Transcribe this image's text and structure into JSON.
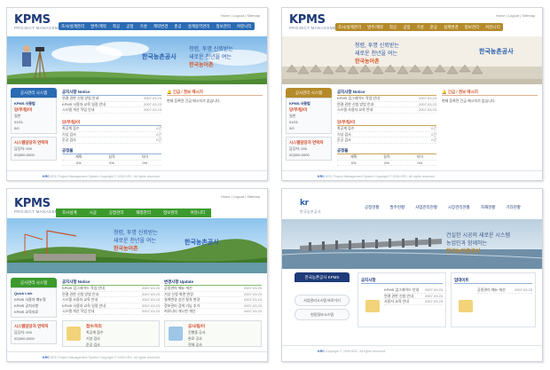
{
  "t1": {
    "logo": "KPMS",
    "logo_sub": "PROJECT MANAGEMENT",
    "menu": [
      "조사/설계관리",
      "발주/계약",
      "착공",
      "공정",
      "기성",
      "계약변경",
      "준공",
      "설계용역관리",
      "정보관리",
      "커뮤니티"
    ],
    "slogan_1": "청렴, 투명 신뢰받는",
    "slogan_2": "새로운 천년을 여는",
    "slogan_3": "한국농어촌",
    "krc": "한국농촌공사",
    "side_tab": "공사관리 시스템",
    "side_title": "KPMS 사용법",
    "side_lines": [
      "당/부/팀/이",
      "일반",
      "01/01",
      "0/0"
    ],
    "side_notice": "시스템담당자 연락처",
    "side_tel": [
      "담당자: 000",
      "02)000-0000"
    ],
    "notice_title": "공지사항 Notice",
    "notices": [
      {
        "t": "연결 권한 신청 방법 안내",
        "d": "2007.03.23"
      },
      {
        "t": "KPMS 사용자 교육 일정 안내",
        "d": "2007.03.23"
      },
      {
        "t": "시스템 개선 작업 안내",
        "d": "2007.03.23"
      }
    ],
    "alert_title": "긴급 / 경보 메시지",
    "alert_text": "현재 등록된 긴급 메시지가 없습니다.",
    "approval_title": "당/부/팀/이",
    "approvals": [
      {
        "t": "착공계 접수",
        "d": "0건"
      },
      {
        "t": "기성 검사",
        "d": "0건"
      },
      {
        "t": "준공 검사",
        "d": "0건"
      }
    ],
    "status_title": "공정율",
    "status_cols": [
      "계획",
      "실적",
      "차이"
    ],
    "status_vals": [
      "0%",
      "0%",
      "0%"
    ],
    "footer": "KRC Project Management System Copyright © 2006 KRC. All rights reserved."
  },
  "t2": {
    "logo": "KPMS",
    "logo_sub": "PROJECT MANAGEMENT",
    "menu": [
      "조사/설계관리",
      "발주/계약",
      "착공",
      "공정",
      "기성",
      "준공",
      "설계변경",
      "정보관리",
      "커뮤니티"
    ],
    "slogan_1": "청렴, 투명 신뢰받는",
    "slogan_2": "새로운 천년을 여는",
    "slogan_3": "한국농어촌",
    "krc": "한국농촌공사",
    "side_tab": "공사관리 시스템",
    "side_title": "KPMS 사용법",
    "side_lines": [
      "당/부/팀/이",
      "일반",
      "01/01",
      "0/0"
    ],
    "side_notice": "시스템담당자 연락처",
    "side_tel": [
      "담당자: 000",
      "02)000-0000"
    ],
    "notice_title": "공지사항 Notice",
    "notices": [
      {
        "t": "KPMS 업그레이드 작업 안내",
        "d": "2007.03.23"
      },
      {
        "t": "연결 권한 신청 방법 안내",
        "d": "2007.03.23"
      },
      {
        "t": "시스템 사용자 교육 안내",
        "d": "2007.03.23"
      }
    ],
    "alert_title": "긴급 / 경보 메시지",
    "alert_text": "현재 등록된 긴급 메시지가 없습니다.",
    "approval_title": "당/부/팀/이",
    "approvals": [
      {
        "t": "착공계 접수",
        "d": "0건"
      },
      {
        "t": "기성 검사",
        "d": "0건"
      },
      {
        "t": "준공 검사",
        "d": "0건"
      }
    ],
    "status_title": "공정율",
    "status_cols": [
      "계획",
      "실적",
      "차이"
    ],
    "status_vals": [
      "0%",
      "0%",
      "0%"
    ],
    "footer": "KRC Project Management System Copyright © 2006 KRC. All rights reserved."
  },
  "t3": {
    "logo": "KPMS",
    "logo_sub": "PROJECT MANAGEMENT",
    "menu": [
      "조사설계",
      "시공",
      "공정관리",
      "재정관리",
      "정보관리",
      "커뮤니티"
    ],
    "slogan_1": "청렴, 투명 신뢰받는",
    "slogan_2": "새로운 천년을 여는",
    "slogan_3": "한국농어촌",
    "krc": "한국농촌공사",
    "side_tab": "공사관리 시스템",
    "side_title": "Quick Link",
    "side_lines": [
      "KPMS 사용자 매뉴얼",
      "KPMS 공지사항",
      "KPMS 교육자료"
    ],
    "side_notice": "시스템담당자 연락처",
    "side_tel": [
      "담당자: 000",
      "02)000-0000"
    ],
    "notice_title": "공지사항 Notice",
    "notices": [
      {
        "t": "KPMS 업그레이드 작업 안내",
        "d": "2007.03.23"
      },
      {
        "t": "연결 권한 신청 방법 안내",
        "d": "2007.03.23"
      },
      {
        "t": "시스템 사용자 교육 안내",
        "d": "2007.03.23"
      },
      {
        "t": "KPMS 사용자 교육 일정 안내",
        "d": "2007.03.23"
      },
      {
        "t": "시스템 개선 작업 안내",
        "d": "2007.03.23"
      }
    ],
    "update_title": "변경사항 Update",
    "updates": [
      {
        "t": "공정관리 메뉴 개선",
        "d": "2007.03.23"
      },
      {
        "t": "기성 신청 화면 변경",
        "d": "2007.03.23"
      },
      {
        "t": "설계변경 승인 절차 변경",
        "d": "2007.03.23"
      },
      {
        "t": "정보관리 검색 기능 추가",
        "d": "2007.03.23"
      },
      {
        "t": "커뮤니티 게시판 개선",
        "d": "2007.03.23"
      }
    ],
    "box1_title": "접수/처리",
    "box1_items": [
      "착공계 접수",
      "기성 검사",
      "준공 검사"
    ],
    "box2_title": "공사/팀/이",
    "box2_items": [
      "진행중 공사",
      "완료 공사",
      "전체 공사"
    ],
    "footer": "KRC Project Management System Copyright © 2006 KRC. All rights reserved."
  },
  "t4": {
    "logo_sub": "한국농촌공사",
    "menu": [
      "공정현황",
      "발주현황",
      "사업관리현황",
      "시장관리현황",
      "자재현황",
      "기타현황"
    ],
    "slogan_1": "건실한 시공의 새로운 시스템",
    "slogan_2": "농업인과 함께하는",
    "slogan_3": "한국농어촌공사",
    "side_brand": "한국농촌공사 KPMS",
    "side_buttons": [
      "사업관리시스템 바로가기",
      "현장정보시스템"
    ],
    "notice_title": "공지사항",
    "notices": [
      {
        "t": "KPMS 업그레이드 안내",
        "d": "2007.03.23"
      },
      {
        "t": "연결 권한 신청 안내",
        "d": "2007.03.23"
      },
      {
        "t": "사용자 교육 안내",
        "d": "2007.03.23"
      }
    ],
    "update_title": "업데이트",
    "updates": [
      {
        "t": "공정관리 메뉴 개선",
        "d": "2007.03.23"
      }
    ],
    "footer": "Copyright © 2006 KRC. All rights reserved."
  },
  "colors": {
    "blue_menu": "#2a6bb3",
    "gold_menu": "#b58a2a",
    "green_menu": "#3c9a2d",
    "navy": "#1f3a78",
    "sky": "#9fcdf0"
  }
}
